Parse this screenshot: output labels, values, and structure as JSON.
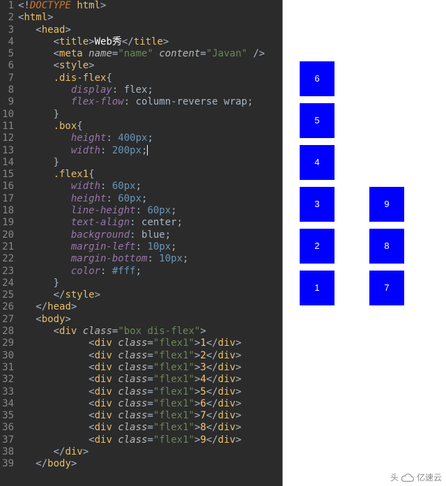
{
  "editor": {
    "lines": [
      {
        "n": 1,
        "indent": 0,
        "segs": [
          [
            "punct",
            "<!"
          ],
          [
            "kw",
            "DOCTYPE"
          ],
          [
            "punct",
            " "
          ],
          [
            "tag",
            "html"
          ],
          [
            "punct",
            ">"
          ]
        ]
      },
      {
        "n": 2,
        "indent": 0,
        "segs": [
          [
            "punct",
            "<"
          ],
          [
            "tag",
            "html"
          ],
          [
            "punct",
            ">"
          ]
        ]
      },
      {
        "n": 3,
        "indent": 1,
        "segs": [
          [
            "punct",
            "<"
          ],
          [
            "tag",
            "head"
          ],
          [
            "punct",
            ">"
          ]
        ]
      },
      {
        "n": 4,
        "indent": 2,
        "segs": [
          [
            "punct",
            "<"
          ],
          [
            "tag",
            "title"
          ],
          [
            "punct",
            ">"
          ],
          [
            "white",
            "Web秀"
          ],
          [
            "punct",
            "</"
          ],
          [
            "tag",
            "title"
          ],
          [
            "punct",
            ">"
          ]
        ]
      },
      {
        "n": 5,
        "indent": 2,
        "segs": [
          [
            "punct",
            "<"
          ],
          [
            "tag",
            "meta"
          ],
          [
            "punct",
            " "
          ],
          [
            "attr",
            "name"
          ],
          [
            "punct",
            "="
          ],
          [
            "str",
            "\"name\""
          ],
          [
            "punct",
            " "
          ],
          [
            "attr",
            "content"
          ],
          [
            "punct",
            "="
          ],
          [
            "str",
            "\"Javan\""
          ],
          [
            "punct",
            " />"
          ]
        ]
      },
      {
        "n": 6,
        "indent": 2,
        "segs": [
          [
            "punct",
            "<"
          ],
          [
            "tag",
            "style"
          ],
          [
            "punct",
            ">"
          ]
        ]
      },
      {
        "n": 7,
        "indent": 2,
        "segs": [
          [
            "sel",
            ".dis-flex"
          ],
          [
            "punct",
            "{"
          ]
        ]
      },
      {
        "n": 8,
        "indent": 3,
        "segs": [
          [
            "prop",
            "display"
          ],
          [
            "punct",
            ": "
          ],
          [
            "txt",
            "flex"
          ],
          [
            "punct",
            ";"
          ]
        ]
      },
      {
        "n": 9,
        "indent": 3,
        "segs": [
          [
            "prop",
            "flex-flow"
          ],
          [
            "punct",
            ": "
          ],
          [
            "txt",
            "column-reverse wrap"
          ],
          [
            "punct",
            ";"
          ]
        ]
      },
      {
        "n": 10,
        "indent": 2,
        "segs": [
          [
            "punct",
            "}"
          ]
        ]
      },
      {
        "n": 11,
        "indent": 2,
        "segs": [
          [
            "sel",
            ".box"
          ],
          [
            "punct",
            "{"
          ]
        ]
      },
      {
        "n": 12,
        "indent": 3,
        "segs": [
          [
            "prop",
            "height"
          ],
          [
            "punct",
            ": "
          ],
          [
            "num",
            "400px"
          ],
          [
            "punct",
            ";"
          ]
        ]
      },
      {
        "n": 13,
        "indent": 3,
        "segs": [
          [
            "prop",
            "width"
          ],
          [
            "punct",
            ": "
          ],
          [
            "num",
            "200px"
          ],
          [
            "punct",
            ";"
          ],
          [
            "cursor",
            ""
          ]
        ]
      },
      {
        "n": 14,
        "indent": 2,
        "segs": [
          [
            "punct",
            "}"
          ]
        ]
      },
      {
        "n": 15,
        "indent": 2,
        "segs": [
          [
            "sel",
            ".flex1"
          ],
          [
            "punct",
            "{"
          ]
        ]
      },
      {
        "n": 16,
        "indent": 3,
        "segs": [
          [
            "prop",
            "width"
          ],
          [
            "punct",
            ": "
          ],
          [
            "num",
            "60px"
          ],
          [
            "punct",
            ";"
          ]
        ]
      },
      {
        "n": 17,
        "indent": 3,
        "segs": [
          [
            "prop",
            "height"
          ],
          [
            "punct",
            ": "
          ],
          [
            "num",
            "60px"
          ],
          [
            "punct",
            ";"
          ]
        ]
      },
      {
        "n": 18,
        "indent": 3,
        "segs": [
          [
            "prop",
            "line-height"
          ],
          [
            "punct",
            ": "
          ],
          [
            "num",
            "60px"
          ],
          [
            "punct",
            ";"
          ]
        ]
      },
      {
        "n": 19,
        "indent": 3,
        "segs": [
          [
            "prop",
            "text-align"
          ],
          [
            "punct",
            ": "
          ],
          [
            "txt",
            "center"
          ],
          [
            "punct",
            ";"
          ]
        ]
      },
      {
        "n": 20,
        "indent": 3,
        "segs": [
          [
            "prop",
            "background"
          ],
          [
            "punct",
            ": "
          ],
          [
            "txt",
            "blue"
          ],
          [
            "punct",
            ";"
          ]
        ]
      },
      {
        "n": 21,
        "indent": 3,
        "segs": [
          [
            "prop",
            "margin-left"
          ],
          [
            "punct",
            ": "
          ],
          [
            "num",
            "10px"
          ],
          [
            "punct",
            ";"
          ]
        ]
      },
      {
        "n": 22,
        "indent": 3,
        "segs": [
          [
            "prop",
            "margin-bottom"
          ],
          [
            "punct",
            ": "
          ],
          [
            "num",
            "10px"
          ],
          [
            "punct",
            ";"
          ]
        ]
      },
      {
        "n": 23,
        "indent": 3,
        "segs": [
          [
            "prop",
            "color"
          ],
          [
            "punct",
            ": "
          ],
          [
            "num",
            "#fff"
          ],
          [
            "punct",
            ";"
          ]
        ]
      },
      {
        "n": 24,
        "indent": 2,
        "segs": [
          [
            "punct",
            "}"
          ]
        ]
      },
      {
        "n": 25,
        "indent": 2,
        "segs": [
          [
            "punct",
            "</"
          ],
          [
            "tag",
            "style"
          ],
          [
            "punct",
            ">"
          ]
        ]
      },
      {
        "n": 26,
        "indent": 1,
        "segs": [
          [
            "punct",
            "</"
          ],
          [
            "tag",
            "head"
          ],
          [
            "punct",
            ">"
          ]
        ]
      },
      {
        "n": 27,
        "indent": 1,
        "segs": [
          [
            "punct",
            "<"
          ],
          [
            "tag",
            "body"
          ],
          [
            "punct",
            ">"
          ]
        ]
      },
      {
        "n": 28,
        "indent": 2,
        "segs": [
          [
            "punct",
            "<"
          ],
          [
            "tag",
            "div"
          ],
          [
            "punct",
            " "
          ],
          [
            "attr",
            "class"
          ],
          [
            "punct",
            "="
          ],
          [
            "str",
            "\"box dis-flex\""
          ],
          [
            "punct",
            ">"
          ]
        ]
      },
      {
        "n": 29,
        "indent": 4,
        "segs": [
          [
            "punct",
            "<"
          ],
          [
            "tag",
            "div"
          ],
          [
            "punct",
            " "
          ],
          [
            "attr",
            "class"
          ],
          [
            "punct",
            "="
          ],
          [
            "str",
            "\"flex1\""
          ],
          [
            "punct",
            ">"
          ],
          [
            "tag2",
            "1"
          ],
          [
            "punct",
            "</"
          ],
          [
            "tag",
            "div"
          ],
          [
            "punct",
            ">"
          ]
        ]
      },
      {
        "n": 30,
        "indent": 4,
        "segs": [
          [
            "punct",
            "<"
          ],
          [
            "tag",
            "div"
          ],
          [
            "punct",
            " "
          ],
          [
            "attr",
            "class"
          ],
          [
            "punct",
            "="
          ],
          [
            "str",
            "\"flex1\""
          ],
          [
            "punct",
            ">"
          ],
          [
            "tag2",
            "2"
          ],
          [
            "punct",
            "</"
          ],
          [
            "tag",
            "div"
          ],
          [
            "punct",
            ">"
          ]
        ]
      },
      {
        "n": 31,
        "indent": 4,
        "segs": [
          [
            "punct",
            "<"
          ],
          [
            "tag",
            "div"
          ],
          [
            "punct",
            " "
          ],
          [
            "attr",
            "class"
          ],
          [
            "punct",
            "="
          ],
          [
            "str",
            "\"flex1\""
          ],
          [
            "punct",
            ">"
          ],
          [
            "tag2",
            "3"
          ],
          [
            "punct",
            "</"
          ],
          [
            "tag",
            "div"
          ],
          [
            "punct",
            ">"
          ]
        ]
      },
      {
        "n": 32,
        "indent": 4,
        "segs": [
          [
            "punct",
            "<"
          ],
          [
            "tag",
            "div"
          ],
          [
            "punct",
            " "
          ],
          [
            "attr",
            "class"
          ],
          [
            "punct",
            "="
          ],
          [
            "str",
            "\"flex1\""
          ],
          [
            "punct",
            ">"
          ],
          [
            "tag2",
            "4"
          ],
          [
            "punct",
            "</"
          ],
          [
            "tag",
            "div"
          ],
          [
            "punct",
            ">"
          ]
        ]
      },
      {
        "n": 33,
        "indent": 4,
        "segs": [
          [
            "punct",
            "<"
          ],
          [
            "tag",
            "div"
          ],
          [
            "punct",
            " "
          ],
          [
            "attr",
            "class"
          ],
          [
            "punct",
            "="
          ],
          [
            "str",
            "\"flex1\""
          ],
          [
            "punct",
            ">"
          ],
          [
            "tag2",
            "5"
          ],
          [
            "punct",
            "</"
          ],
          [
            "tag",
            "div"
          ],
          [
            "punct",
            ">"
          ]
        ]
      },
      {
        "n": 34,
        "indent": 4,
        "segs": [
          [
            "punct",
            "<"
          ],
          [
            "tag",
            "div"
          ],
          [
            "punct",
            " "
          ],
          [
            "attr",
            "class"
          ],
          [
            "punct",
            "="
          ],
          [
            "str",
            "\"flex1\""
          ],
          [
            "punct",
            ">"
          ],
          [
            "tag2",
            "6"
          ],
          [
            "punct",
            "</"
          ],
          [
            "tag",
            "div"
          ],
          [
            "punct",
            ">"
          ]
        ]
      },
      {
        "n": 35,
        "indent": 4,
        "segs": [
          [
            "punct",
            "<"
          ],
          [
            "tag",
            "div"
          ],
          [
            "punct",
            " "
          ],
          [
            "attr",
            "class"
          ],
          [
            "punct",
            "="
          ],
          [
            "str",
            "\"flex1\""
          ],
          [
            "punct",
            ">"
          ],
          [
            "tag2",
            "7"
          ],
          [
            "punct",
            "</"
          ],
          [
            "tag",
            "div"
          ],
          [
            "punct",
            ">"
          ]
        ]
      },
      {
        "n": 36,
        "indent": 4,
        "segs": [
          [
            "punct",
            "<"
          ],
          [
            "tag",
            "div"
          ],
          [
            "punct",
            " "
          ],
          [
            "attr",
            "class"
          ],
          [
            "punct",
            "="
          ],
          [
            "str",
            "\"flex1\""
          ],
          [
            "punct",
            ">"
          ],
          [
            "tag2",
            "8"
          ],
          [
            "punct",
            "</"
          ],
          [
            "tag",
            "div"
          ],
          [
            "punct",
            ">"
          ]
        ]
      },
      {
        "n": 37,
        "indent": 4,
        "segs": [
          [
            "punct",
            "<"
          ],
          [
            "tag",
            "div"
          ],
          [
            "punct",
            " "
          ],
          [
            "attr",
            "class"
          ],
          [
            "punct",
            "="
          ],
          [
            "str",
            "\"flex1\""
          ],
          [
            "punct",
            ">"
          ],
          [
            "tag2",
            "9"
          ],
          [
            "punct",
            "</"
          ],
          [
            "tag",
            "div"
          ],
          [
            "punct",
            ">"
          ]
        ]
      },
      {
        "n": 38,
        "indent": 2,
        "segs": [
          [
            "punct",
            "</"
          ],
          [
            "tag",
            "div"
          ],
          [
            "punct",
            ">"
          ]
        ]
      },
      {
        "n": 39,
        "indent": 1,
        "segs": [
          [
            "punct",
            "</"
          ],
          [
            "tag",
            "body"
          ],
          [
            "punct",
            ">"
          ]
        ]
      }
    ]
  },
  "preview": {
    "items": [
      "1",
      "2",
      "3",
      "4",
      "5",
      "6",
      "7",
      "8",
      "9"
    ]
  },
  "watermark": {
    "text": "头",
    "brand": "亿速云"
  }
}
